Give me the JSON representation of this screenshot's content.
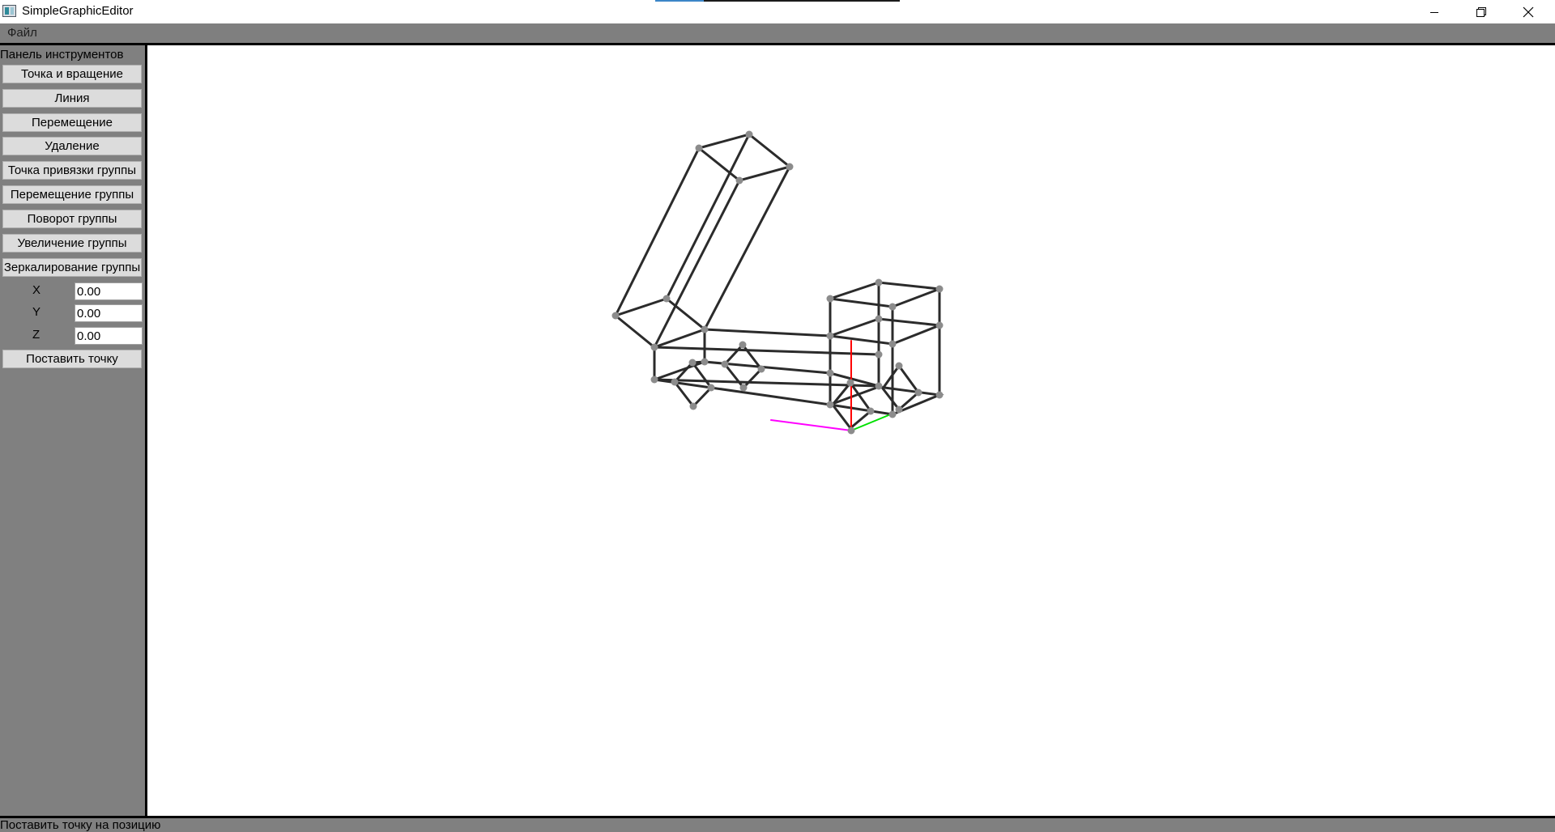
{
  "window": {
    "title": "SimpleGraphicEditor"
  },
  "menu": {
    "file_label": "Файл"
  },
  "toolbar": {
    "title": "Панель инструментов",
    "buttons": [
      "Точка и вращение",
      "Линия",
      "Перемещение",
      "Удаление",
      "Точка привязки группы",
      "Перемещение группы",
      "Поворот группы",
      "Увеличение группы",
      "Зеркалирование группы"
    ],
    "coords": {
      "x_label": "X",
      "x_value": "0.00",
      "y_label": "Y",
      "y_value": "0.00",
      "z_label": "Z",
      "z_value": "0.00"
    },
    "place_point_label": "Поставить точку"
  },
  "status": {
    "text": "Поставить точку на позицию"
  },
  "colors": {
    "panel_bg": "#808080",
    "button_bg": "#dcdcdc",
    "edge": "#2b2b2b",
    "vertex": "#8c8c8c",
    "axis_x": "#ff00ff",
    "axis_y": "#ff0000",
    "axis_z": "#00e000"
  },
  "icons": {
    "minimize": "minimize-icon",
    "restore": "restore-icon",
    "close": "close-icon",
    "app": "app-icon"
  }
}
